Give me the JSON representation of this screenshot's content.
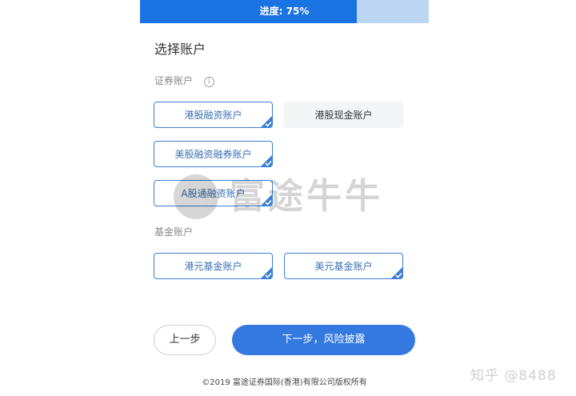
{
  "progress": {
    "label": "进度: 75%",
    "percent": 75
  },
  "page": {
    "title": "选择账户"
  },
  "sections": {
    "securities_label": "证券账户",
    "securities_info_icon": "info-icon",
    "funds_label": "基金账户"
  },
  "accounts": {
    "hk_margin": "港股融资账户",
    "hk_cash": "港股现金账户",
    "us_margin_short": "美股融资融券账户",
    "a_share_margin": "A股通融资账户",
    "hkd_fund": "港元基金账户",
    "usd_fund": "美元基金账户"
  },
  "selection": {
    "hk_margin": true,
    "hk_cash": false,
    "us_margin_short": true,
    "a_share_margin": true,
    "hkd_fund": true,
    "usd_fund": true
  },
  "watermark": {
    "text": "富途牛牛"
  },
  "buttons": {
    "prev": "上一步",
    "next": "下一步，风险披露"
  },
  "footer": {
    "copyright": "©2019 富途证券国际(香港)有限公司版权所有"
  },
  "source_mark": {
    "text": "知乎 @8488"
  },
  "colors": {
    "accent": "#3379df",
    "progress_fill": "#1a73e3",
    "progress_track": "#bcd5f2",
    "selected_border": "#3b7fd6",
    "unselected_bg": "#f3f4f6"
  }
}
